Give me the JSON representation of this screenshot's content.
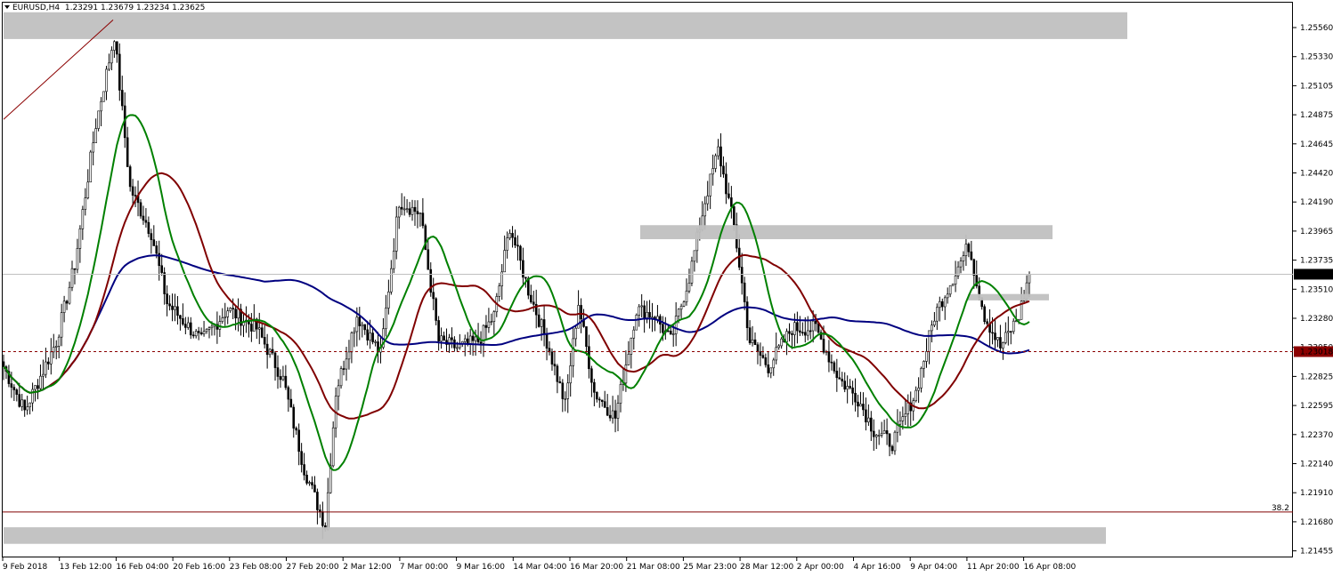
{
  "header": {
    "symbol": "EURUSD,H4",
    "ohlc": "1.23291 1.23679 1.23234 1.23625"
  },
  "price_axis": {
    "labels": [
      "1.25560",
      "1.25330",
      "1.25105",
      "1.24875",
      "1.24645",
      "1.24420",
      "1.24190",
      "1.23965",
      "1.23735",
      "1.23510",
      "1.23280",
      "1.23050",
      "1.22825",
      "1.22595",
      "1.22370",
      "1.22140",
      "1.21910",
      "1.21680",
      "1.21455"
    ],
    "current_price_label": "1.23625",
    "line_price_label": "1.23018"
  },
  "time_axis": {
    "labels": [
      "9 Feb 2018",
      "13 Feb 12:00",
      "16 Feb 04:00",
      "20 Feb 16:00",
      "23 Feb 08:00",
      "27 Feb 20:00",
      "2 Mar 12:00",
      "7 Mar 00:00",
      "9 Mar 16:00",
      "14 Mar 04:00",
      "16 Mar 20:00",
      "21 Mar 08:00",
      "25 Mar 23:00",
      "28 Mar 12:00",
      "2 Apr 00:00",
      "4 Apr 16:00",
      "9 Apr 04:00",
      "11 Apr 20:00",
      "16 Apr 08:00"
    ]
  },
  "fib": {
    "label": "38.2"
  },
  "colors": {
    "background": "#ffffff",
    "candle": "#000000",
    "ma_fast": "#008000",
    "ma_mid": "#800000",
    "ma_slow": "#000080",
    "zone": "#c0c0c0",
    "fib_line": "#800000",
    "price_line": "#c0c0c0",
    "trend_line": "#8b0000",
    "dashed_line": "#8b0000"
  }
}
